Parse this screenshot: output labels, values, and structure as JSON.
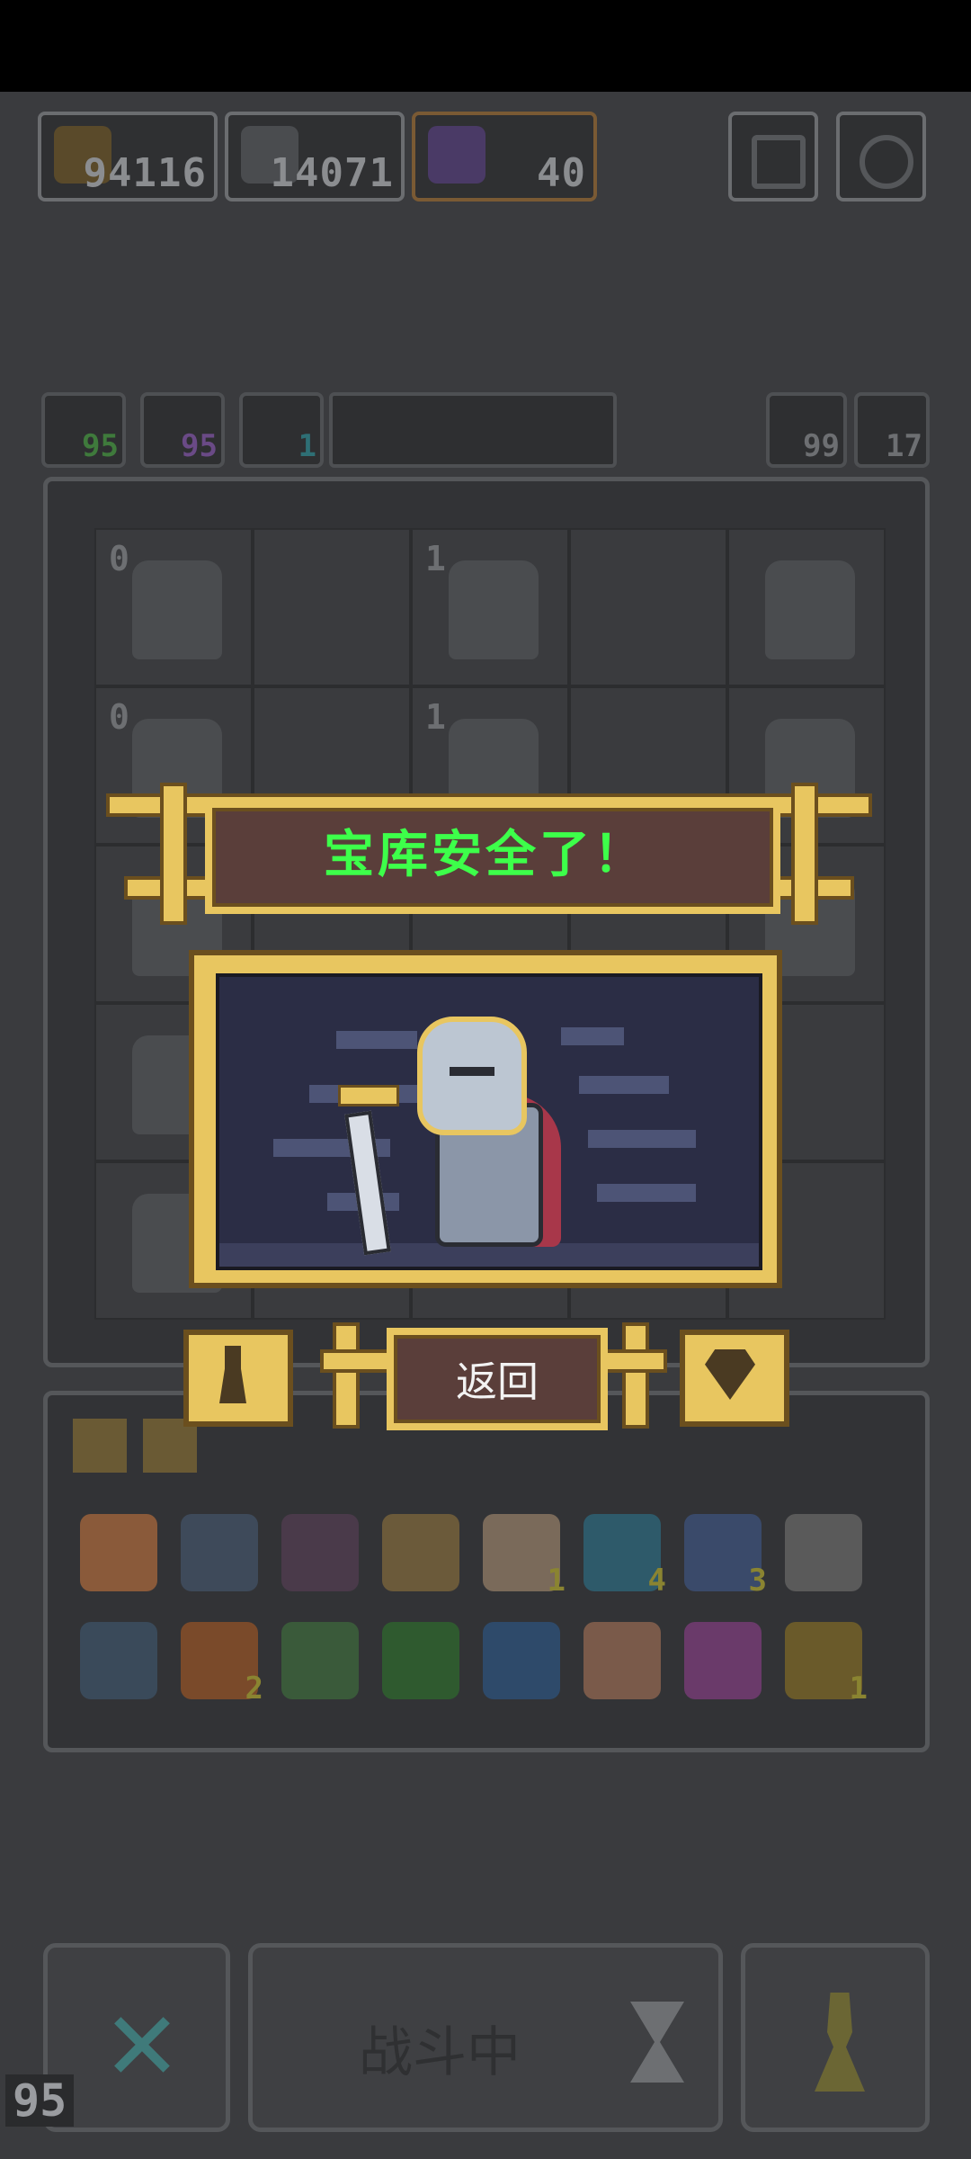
{
  "resources": [
    {
      "name": "axe-resource",
      "value": "94116",
      "color": "#c9a24a"
    },
    {
      "name": "helmet-resource",
      "value": "14071",
      "color": "#6b6d70"
    },
    {
      "name": "energy-resource",
      "value": "40",
      "color": "#c07a2a"
    }
  ],
  "consumables": [
    {
      "name": "green-potion",
      "value": "95",
      "color": "#3f7a3c"
    },
    {
      "name": "purple-bolt",
      "value": "95",
      "color": "#6a4a86"
    },
    {
      "name": "teal-ring",
      "value": "1",
      "color": "#2e6f75"
    }
  ],
  "side_counters": {
    "left": "99",
    "right": "17"
  },
  "grid": {
    "levels": [
      "0",
      "",
      "1",
      "",
      "",
      "0",
      "",
      "1",
      "",
      "",
      "",
      "",
      "",
      "",
      "",
      "",
      "",
      "",
      "",
      "",
      "",
      "",
      "",
      "",
      ""
    ]
  },
  "modal": {
    "title": "宝库安全了！",
    "back_label": "返回"
  },
  "inventory": {
    "row1_counts": [
      "",
      "",
      "",
      "",
      "1",
      "4",
      "3",
      ""
    ],
    "row2_counts": [
      "",
      "2",
      "",
      "",
      "",
      "",
      "",
      "1"
    ]
  },
  "bottom": {
    "battle_label": "战斗中",
    "corner_number": "95"
  }
}
